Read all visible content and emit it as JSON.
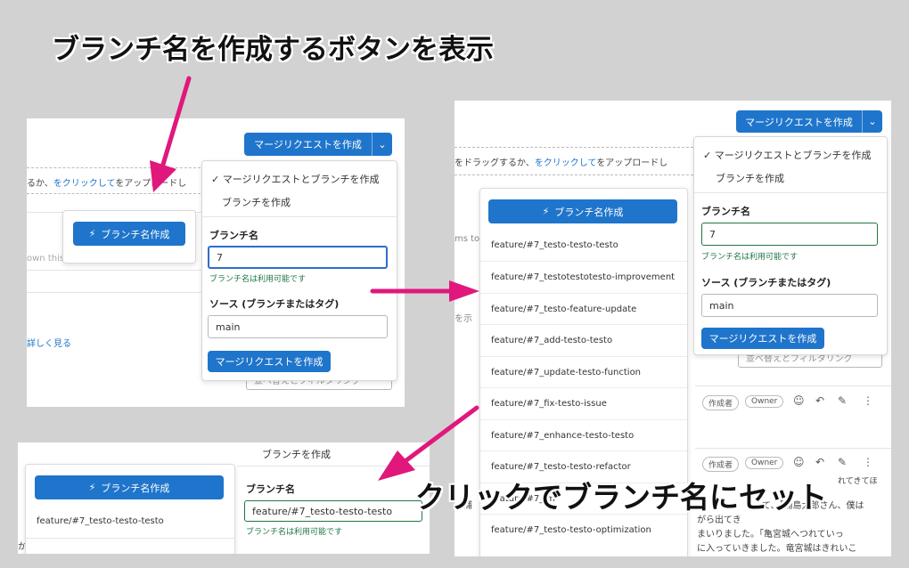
{
  "captions": {
    "top": "ブランチ名を作成するボタンを表示",
    "bottom": "クリックでブランチ名にセット"
  },
  "colors": {
    "accent": "#1f75cb",
    "arrow": "#e0187c",
    "success": "#217645"
  },
  "icons": {
    "wand": "magic-wand-icon",
    "chevron": "chevron-down-icon",
    "check": "check-icon"
  },
  "panel1": {
    "split_button": "マージリクエストを作成",
    "dashed_text_a": "るか、",
    "dashed_link": "をクリックして",
    "dashed_text_b": "をアップロードし",
    "row_text": "own this issue into smaller parts",
    "learn_more": "詳しく見る",
    "filter_text": "並べ替えとフィルタリング",
    "generate_button": "ブランチ名作成",
    "dropdown": {
      "option1": "マージリクエストとブランチを作成",
      "option2": "ブランチを作成",
      "branch_label": "ブランチ名",
      "branch_value": "7",
      "available": "ブランチ名は利用可能です",
      "source_label": "ソース (ブランチまたはタグ)",
      "source_value": "main",
      "submit": "マージリクエストを作成"
    }
  },
  "panel2": {
    "split_button": "マージリクエストを作成",
    "dashed_text_a": "をドラッグするか、",
    "dashed_link": "をクリックして",
    "dashed_text_b": "をアップロードし",
    "frag1": "ms to",
    "frag2": "を示",
    "filter_text": "並べ替えとフィルタリング",
    "generate_button": "ブランチ名作成",
    "suggestions": [
      "feature/#7_testo-testo-testo",
      "feature/#7_testotestotesto-improvement",
      "feature/#7_testo-feature-update",
      "feature/#7_add-testo-testo",
      "feature/#7_update-testo-function",
      "feature/#7_fix-testo-issue",
      "feature/#7_enhance-testo-testo",
      "feature/#7_testo-testo-refactor",
      "feature/#7_im",
      "feature/#7_testo-testo-optimization"
    ],
    "dropdown": {
      "option1": "マージリクエストとブランチを作成",
      "option2": "ブランチを作成",
      "branch_label": "ブランチ名",
      "branch_value": "7",
      "available": "ブランチ名は利用可能です",
      "source_label": "ソース (ブランチまたはタグ)",
      "source_value": "main",
      "submit": "マージリクエストを作成"
    },
    "comment": {
      "author_badge": "作成者",
      "owner_badge": "Owner",
      "text_lines": [
        "、浦",
        "がら出てき",
        "まいりました。「亀宮城へつれていっ",
        "に入っていきました。竜宮城はきれいこ"
      ],
      "text_line2b": "て、「浦島太郎さん、僕は",
      "frag_more": "れてきてほ"
    }
  },
  "panel3": {
    "header_text": "ブランチを作成",
    "generate_button": "ブランチ名作成",
    "suggestion": "feature/#7_testo-testo-testo",
    "branch_label": "ブランチ名",
    "branch_value": "feature/#7_testo-testo-testo",
    "available": "ブランチ名は利用可能です",
    "left_frag": "か」"
  }
}
